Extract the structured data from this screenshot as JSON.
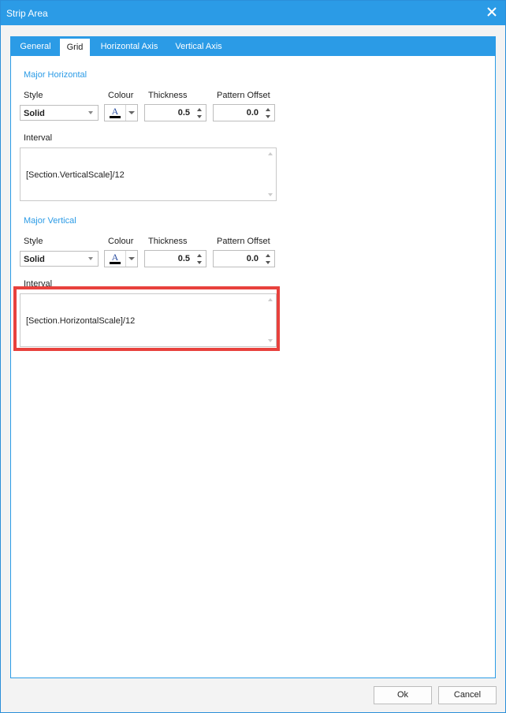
{
  "window": {
    "title": "Strip Area"
  },
  "tabs": [
    {
      "label": "General"
    },
    {
      "label": "Grid"
    },
    {
      "label": "Horizontal Axis"
    },
    {
      "label": "Vertical Axis"
    }
  ],
  "active_tab": "Grid",
  "major_horizontal": {
    "title": "Major Horizontal",
    "style_label": "Style",
    "style_value": "Solid",
    "colour_label": "Colour",
    "colour_value": "#000000",
    "thickness_label": "Thickness",
    "thickness_value": "0.5",
    "offset_label": "Pattern Offset",
    "offset_value": "0.0",
    "interval_label": "Interval",
    "interval_value": "[Section.VerticalScale]/12"
  },
  "major_vertical": {
    "title": "Major Vertical",
    "style_label": "Style",
    "style_value": "Solid",
    "colour_label": "Colour",
    "colour_value": "#000000",
    "thickness_label": "Thickness",
    "thickness_value": "0.5",
    "offset_label": "Pattern Offset",
    "offset_value": "0.0",
    "interval_label": "Interval",
    "interval_value": "[Section.HorizontalScale]/12"
  },
  "buttons": {
    "ok": "Ok",
    "cancel": "Cancel"
  },
  "colors": {
    "accent": "#2b9be6",
    "highlight": "#e8413d"
  }
}
